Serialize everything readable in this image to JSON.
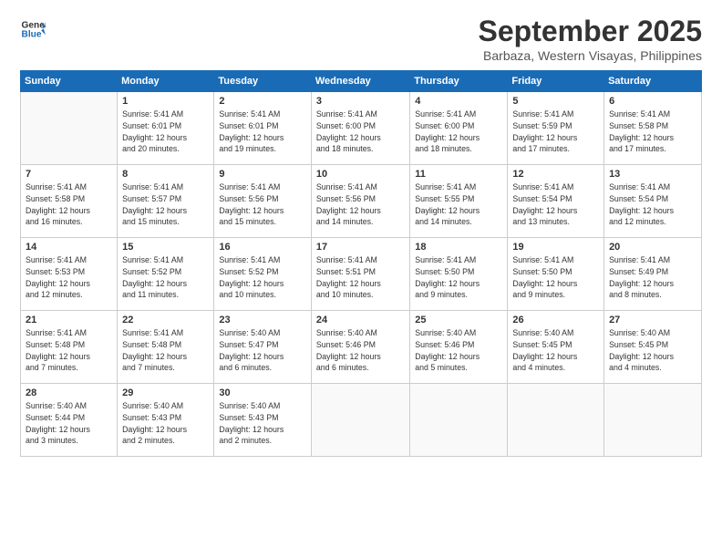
{
  "logo": {
    "line1": "General",
    "line2": "Blue"
  },
  "title": "September 2025",
  "location": "Barbaza, Western Visayas, Philippines",
  "weekdays": [
    "Sunday",
    "Monday",
    "Tuesday",
    "Wednesday",
    "Thursday",
    "Friday",
    "Saturday"
  ],
  "weeks": [
    [
      {
        "day": "",
        "info": ""
      },
      {
        "day": "1",
        "info": "Sunrise: 5:41 AM\nSunset: 6:01 PM\nDaylight: 12 hours\nand 20 minutes."
      },
      {
        "day": "2",
        "info": "Sunrise: 5:41 AM\nSunset: 6:01 PM\nDaylight: 12 hours\nand 19 minutes."
      },
      {
        "day": "3",
        "info": "Sunrise: 5:41 AM\nSunset: 6:00 PM\nDaylight: 12 hours\nand 18 minutes."
      },
      {
        "day": "4",
        "info": "Sunrise: 5:41 AM\nSunset: 6:00 PM\nDaylight: 12 hours\nand 18 minutes."
      },
      {
        "day": "5",
        "info": "Sunrise: 5:41 AM\nSunset: 5:59 PM\nDaylight: 12 hours\nand 17 minutes."
      },
      {
        "day": "6",
        "info": "Sunrise: 5:41 AM\nSunset: 5:58 PM\nDaylight: 12 hours\nand 17 minutes."
      }
    ],
    [
      {
        "day": "7",
        "info": "Sunrise: 5:41 AM\nSunset: 5:58 PM\nDaylight: 12 hours\nand 16 minutes."
      },
      {
        "day": "8",
        "info": "Sunrise: 5:41 AM\nSunset: 5:57 PM\nDaylight: 12 hours\nand 15 minutes."
      },
      {
        "day": "9",
        "info": "Sunrise: 5:41 AM\nSunset: 5:56 PM\nDaylight: 12 hours\nand 15 minutes."
      },
      {
        "day": "10",
        "info": "Sunrise: 5:41 AM\nSunset: 5:56 PM\nDaylight: 12 hours\nand 14 minutes."
      },
      {
        "day": "11",
        "info": "Sunrise: 5:41 AM\nSunset: 5:55 PM\nDaylight: 12 hours\nand 14 minutes."
      },
      {
        "day": "12",
        "info": "Sunrise: 5:41 AM\nSunset: 5:54 PM\nDaylight: 12 hours\nand 13 minutes."
      },
      {
        "day": "13",
        "info": "Sunrise: 5:41 AM\nSunset: 5:54 PM\nDaylight: 12 hours\nand 12 minutes."
      }
    ],
    [
      {
        "day": "14",
        "info": "Sunrise: 5:41 AM\nSunset: 5:53 PM\nDaylight: 12 hours\nand 12 minutes."
      },
      {
        "day": "15",
        "info": "Sunrise: 5:41 AM\nSunset: 5:52 PM\nDaylight: 12 hours\nand 11 minutes."
      },
      {
        "day": "16",
        "info": "Sunrise: 5:41 AM\nSunset: 5:52 PM\nDaylight: 12 hours\nand 10 minutes."
      },
      {
        "day": "17",
        "info": "Sunrise: 5:41 AM\nSunset: 5:51 PM\nDaylight: 12 hours\nand 10 minutes."
      },
      {
        "day": "18",
        "info": "Sunrise: 5:41 AM\nSunset: 5:50 PM\nDaylight: 12 hours\nand 9 minutes."
      },
      {
        "day": "19",
        "info": "Sunrise: 5:41 AM\nSunset: 5:50 PM\nDaylight: 12 hours\nand 9 minutes."
      },
      {
        "day": "20",
        "info": "Sunrise: 5:41 AM\nSunset: 5:49 PM\nDaylight: 12 hours\nand 8 minutes."
      }
    ],
    [
      {
        "day": "21",
        "info": "Sunrise: 5:41 AM\nSunset: 5:48 PM\nDaylight: 12 hours\nand 7 minutes."
      },
      {
        "day": "22",
        "info": "Sunrise: 5:41 AM\nSunset: 5:48 PM\nDaylight: 12 hours\nand 7 minutes."
      },
      {
        "day": "23",
        "info": "Sunrise: 5:40 AM\nSunset: 5:47 PM\nDaylight: 12 hours\nand 6 minutes."
      },
      {
        "day": "24",
        "info": "Sunrise: 5:40 AM\nSunset: 5:46 PM\nDaylight: 12 hours\nand 6 minutes."
      },
      {
        "day": "25",
        "info": "Sunrise: 5:40 AM\nSunset: 5:46 PM\nDaylight: 12 hours\nand 5 minutes."
      },
      {
        "day": "26",
        "info": "Sunrise: 5:40 AM\nSunset: 5:45 PM\nDaylight: 12 hours\nand 4 minutes."
      },
      {
        "day": "27",
        "info": "Sunrise: 5:40 AM\nSunset: 5:45 PM\nDaylight: 12 hours\nand 4 minutes."
      }
    ],
    [
      {
        "day": "28",
        "info": "Sunrise: 5:40 AM\nSunset: 5:44 PM\nDaylight: 12 hours\nand 3 minutes."
      },
      {
        "day": "29",
        "info": "Sunrise: 5:40 AM\nSunset: 5:43 PM\nDaylight: 12 hours\nand 2 minutes."
      },
      {
        "day": "30",
        "info": "Sunrise: 5:40 AM\nSunset: 5:43 PM\nDaylight: 12 hours\nand 2 minutes."
      },
      {
        "day": "",
        "info": ""
      },
      {
        "day": "",
        "info": ""
      },
      {
        "day": "",
        "info": ""
      },
      {
        "day": "",
        "info": ""
      }
    ]
  ]
}
